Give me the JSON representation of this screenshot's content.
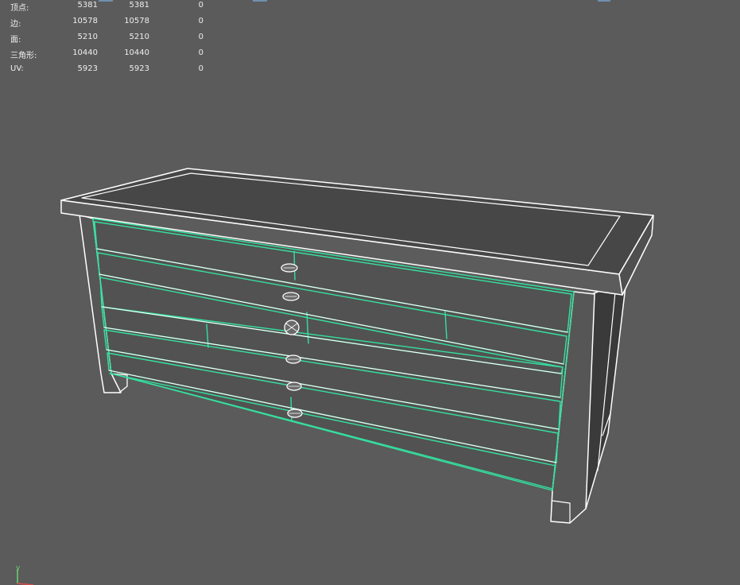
{
  "stats": [
    {
      "label": "顶点:",
      "total": "5381",
      "selected": "5381",
      "extra": "0"
    },
    {
      "label": "边:",
      "total": "10578",
      "selected": "10578",
      "extra": "0"
    },
    {
      "label": "面:",
      "total": "5210",
      "selected": "5210",
      "extra": "0"
    },
    {
      "label": "三角形:",
      "total": "10440",
      "selected": "10440",
      "extra": "0"
    },
    {
      "label": "UV:",
      "total": "5923",
      "selected": "5923",
      "extra": "0"
    }
  ],
  "axis": {
    "y_label": "y"
  },
  "colors": {
    "background": "#5b5b5b",
    "wire": "#ffffff",
    "selection": "#35e0a0",
    "top_face": "#474747",
    "front_face": "#525252",
    "side_face": "#3a3a3a",
    "axis_y": "#6bd36b",
    "axis_x": "#d84a4a"
  }
}
